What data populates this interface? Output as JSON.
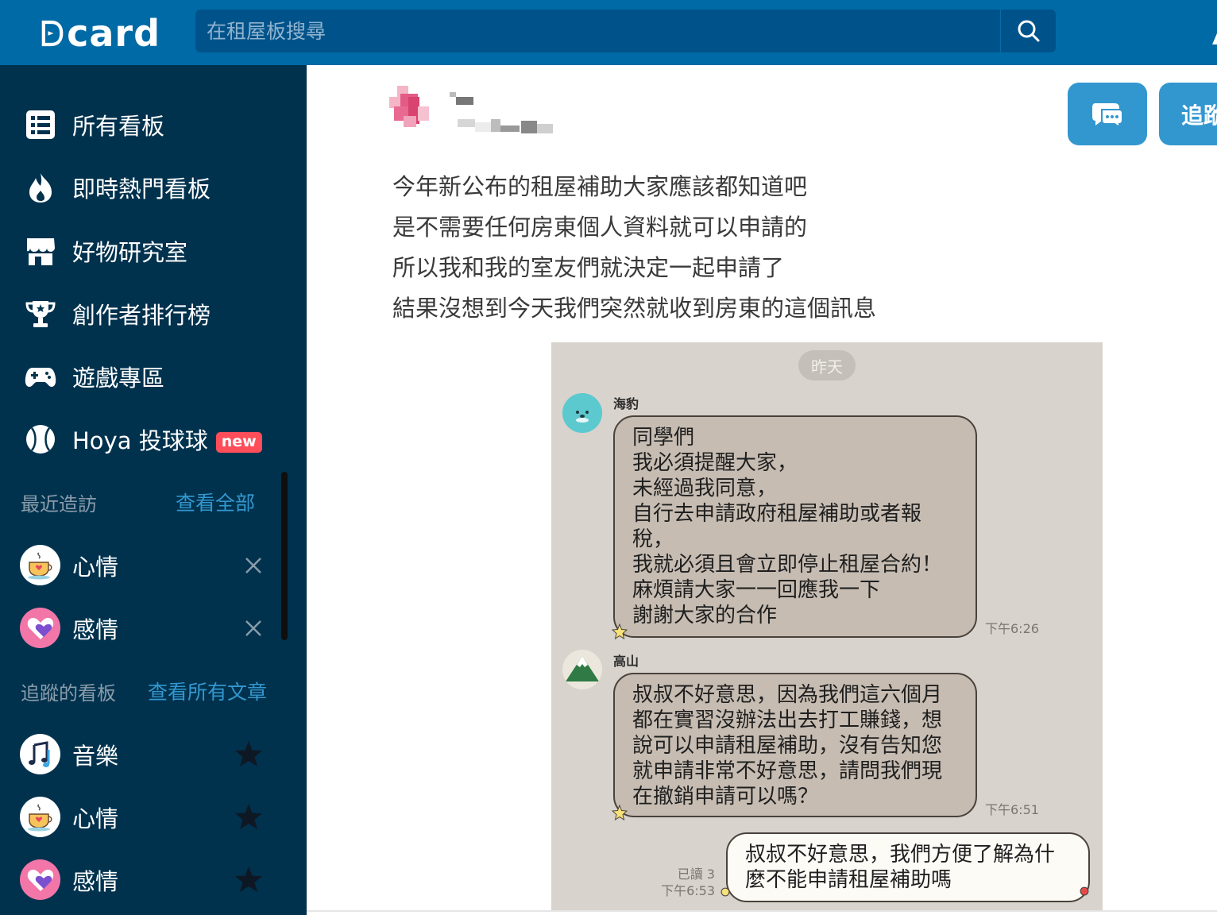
{
  "app": {
    "logo_text": "card",
    "brand_color": "#006aa6",
    "sidebar_color": "#00324e",
    "accent_color": "#3397cf"
  },
  "search": {
    "placeholder": "在租屋板搜尋",
    "icon": "search-icon"
  },
  "sidebar": {
    "nav": [
      {
        "label": "所有看板",
        "icon": "list-icon"
      },
      {
        "label": "即時熱門看板",
        "icon": "flame-icon"
      },
      {
        "label": "好物研究室",
        "icon": "store-icon"
      },
      {
        "label": "創作者排行榜",
        "icon": "trophy-icon"
      },
      {
        "label": "遊戲專區",
        "icon": "gamepad-icon"
      },
      {
        "label": "Hoya 投球球",
        "icon": "baseball-icon",
        "badge": "new"
      }
    ],
    "recent": {
      "title": "最近造訪",
      "link": "查看全部",
      "items": [
        {
          "label": "心情",
          "icon": "coffee-cup-icon"
        },
        {
          "label": "感情",
          "icon": "heart-icon"
        }
      ]
    },
    "following": {
      "title": "追蹤的看板",
      "link": "查看所有文章",
      "items": [
        {
          "label": "音樂",
          "icon": "music-note-icon"
        },
        {
          "label": "心情",
          "icon": "coffee-cup-icon"
        },
        {
          "label": "感情",
          "icon": "heart-icon"
        }
      ]
    }
  },
  "post": {
    "follow_label": "追蹤",
    "lines": [
      "今年新公布的租屋補助大家應該都知道吧",
      "是不需要任何房東個人資料就可以申請的",
      "所以我和我的室友們就決定一起申請了",
      "結果沒想到今天我們突然就收到房東的這個訊息"
    ]
  },
  "chat": {
    "date": "昨天",
    "messages": [
      {
        "sender": "海豹",
        "lines": [
          "同學們",
          "我必須提醒大家，",
          "未經過我同意，",
          "自行去申請政府租屋補助或者報",
          "稅，",
          "我就必須且會立即停止租屋合約！",
          "麻煩請大家一一回應我一下",
          "謝謝大家的合作"
        ],
        "time": "下午6:26"
      },
      {
        "sender": "高山",
        "lines": [
          "叔叔不好意思，因為我們這六個月",
          "都在實習沒辦法出去打工賺錢，想",
          "說可以申請租屋補助，沒有告知您",
          "就申請非常不好意思，請問我們現",
          "在撤銷申請可以嗎？"
        ],
        "time": "下午6:51"
      },
      {
        "sender": "",
        "lines": [
          "叔叔不好意思，我們方便了解為什",
          "麼不能申請租屋補助嗎"
        ],
        "read": "已讀 3",
        "time": "下午6:53"
      }
    ]
  }
}
